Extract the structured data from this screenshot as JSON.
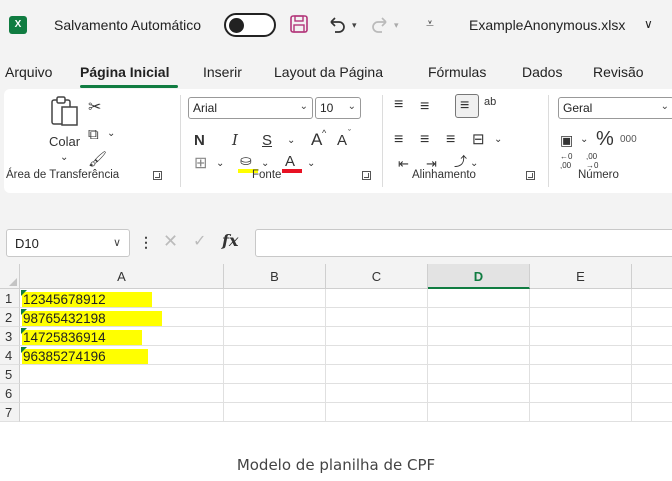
{
  "title_bar": {
    "app_icon": "X",
    "autosave_label": "Salvamento Automático",
    "autosave_state": "off",
    "file_name": "ExampleAnonymous.xlsx",
    "file_menu_chevron": "∨"
  },
  "tabs": [
    {
      "label": "Arquivo",
      "active": false
    },
    {
      "label": "Página Inicial",
      "active": true
    },
    {
      "label": "Inserir",
      "active": false
    },
    {
      "label": "Layout da Página",
      "active": false
    },
    {
      "label": "Fórmulas",
      "active": false
    },
    {
      "label": "Dados",
      "active": false
    },
    {
      "label": "Revisão",
      "active": false
    }
  ],
  "ribbon": {
    "clipboard": {
      "paste_label": "Colar",
      "group_label": "Área de Transferência"
    },
    "font": {
      "font_name": "Arial",
      "font_size": "10",
      "bold": "N",
      "italic": "I",
      "underline": "S",
      "grow": "A",
      "shrink": "A",
      "font_color_letter": "A",
      "group_label": "Fonte",
      "highlight_color": "#ffff00",
      "font_color": "#e81123"
    },
    "alignment": {
      "wrap_label": "ab",
      "group_label": "Alinhamento"
    },
    "number": {
      "format": "Geral",
      "percent": "%",
      "thousands": "000",
      "dec_inc_top": "←0",
      "dec_inc_bottom": ",00",
      "dec_dec_top": ",00",
      "dec_dec_bottom": "→0",
      "group_label": "Número"
    }
  },
  "formula_bar": {
    "name_box": "D10",
    "fx": "fx",
    "formula": ""
  },
  "sheet": {
    "columns": [
      "A",
      "B",
      "C",
      "D",
      "E"
    ],
    "selected_column": "D",
    "rows": [
      {
        "num": "1",
        "a": "12345678912"
      },
      {
        "num": "2",
        "a": "98765432198"
      },
      {
        "num": "3",
        "a": "14725836914"
      },
      {
        "num": "4",
        "a": "96385274196"
      },
      {
        "num": "5",
        "a": ""
      },
      {
        "num": "6",
        "a": ""
      },
      {
        "num": "7",
        "a": ""
      }
    ],
    "highlight": "#ffff00",
    "accent": "#107c41"
  },
  "caption": "Modelo de planilha de CPF"
}
